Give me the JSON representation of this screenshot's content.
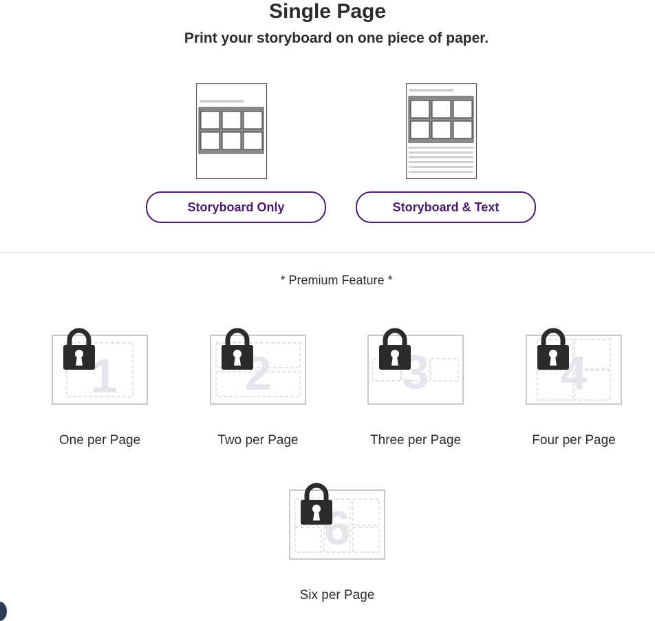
{
  "header": {
    "title": "Single Page",
    "subtitle": "Print your storyboard on one piece of paper."
  },
  "options": {
    "storyboard_only_label": "Storyboard Only",
    "storyboard_text_label": "Storyboard & Text"
  },
  "premium": {
    "label": "* Premium Feature *"
  },
  "layouts": [
    {
      "number": "1",
      "label": "One per Page",
      "icon": "lock-icon"
    },
    {
      "number": "2",
      "label": "Two per Page",
      "icon": "lock-icon"
    },
    {
      "number": "3",
      "label": "Three per Page",
      "icon": "lock-icon"
    },
    {
      "number": "4",
      "label": "Four per Page",
      "icon": "lock-icon"
    },
    {
      "number": "6",
      "label": "Six per Page",
      "icon": "lock-icon"
    }
  ],
  "colors": {
    "accent": "#4a1a6b",
    "text": "#2b2b2b",
    "lock": "#2b2b2b",
    "paper_border": "#c8c8c8"
  }
}
